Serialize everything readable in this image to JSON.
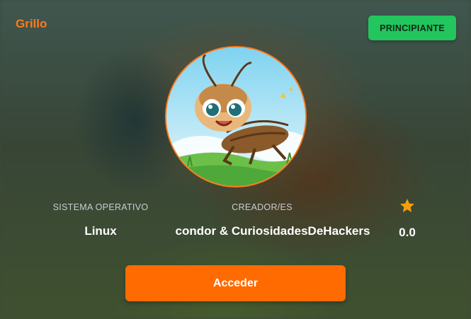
{
  "machine": {
    "name": "Grillo",
    "difficulty": "PRINCIPIANTE",
    "difficulty_color": "#22c55e",
    "accent_color": "#ff6b00"
  },
  "info": {
    "os_label": "SISTEMA OPERATIVO",
    "os_value": "Linux",
    "creator_label": "CREADOR/ES",
    "creator_value": "condor & CuriosidadesDeHackers",
    "rating_icon": "star-icon",
    "rating_value": "0.0"
  },
  "actions": {
    "access_label": "Acceder"
  }
}
